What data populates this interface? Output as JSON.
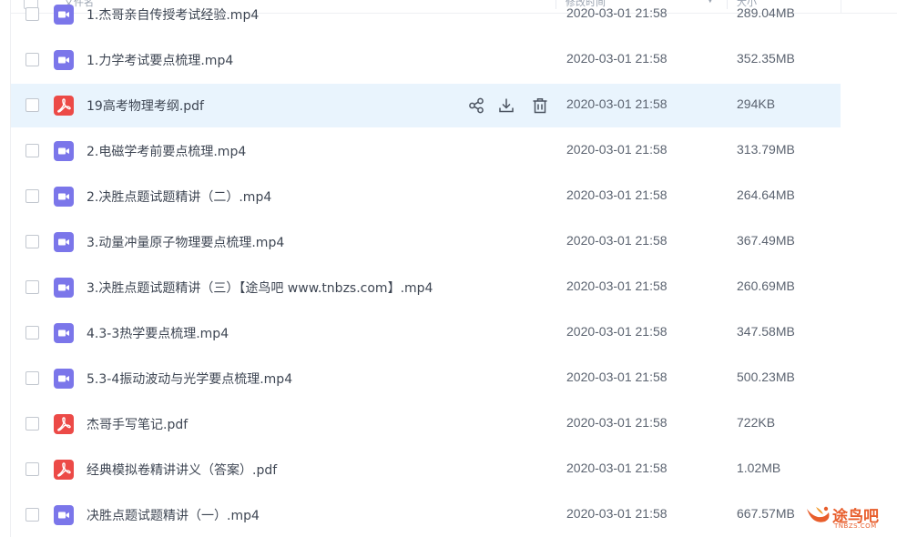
{
  "header": {
    "name_label": "文件名",
    "time_label": "修改时间",
    "size_label": "大小"
  },
  "files": [
    {
      "name": "1.杰哥亲自传授考试经验.mp4",
      "date": "2020-03-01 21:58",
      "size": "289.04MB",
      "type": "video"
    },
    {
      "name": "1.力学考试要点梳理.mp4",
      "date": "2020-03-01 21:58",
      "size": "352.35MB",
      "type": "video"
    },
    {
      "name": "19高考物理考纲.pdf",
      "date": "2020-03-01 21:58",
      "size": "294KB",
      "type": "pdf",
      "selected": true
    },
    {
      "name": "2.电磁学考前要点梳理.mp4",
      "date": "2020-03-01 21:58",
      "size": "313.79MB",
      "type": "video"
    },
    {
      "name": "2.决胜点题试题精讲（二）.mp4",
      "date": "2020-03-01 21:58",
      "size": "264.64MB",
      "type": "video"
    },
    {
      "name": "3.动量冲量原子物理要点梳理.mp4",
      "date": "2020-03-01 21:58",
      "size": "367.49MB",
      "type": "video"
    },
    {
      "name": "3.决胜点题试题精讲（三）【途鸟吧 www.tnbzs.com】.mp4",
      "date": "2020-03-01 21:58",
      "size": "260.69MB",
      "type": "video"
    },
    {
      "name": "4.3-3热学要点梳理.mp4",
      "date": "2020-03-01 21:58",
      "size": "347.58MB",
      "type": "video"
    },
    {
      "name": "5.3-4振动波动与光学要点梳理.mp4",
      "date": "2020-03-01 21:58",
      "size": "500.23MB",
      "type": "video"
    },
    {
      "name": "杰哥手写笔记.pdf",
      "date": "2020-03-01 21:58",
      "size": "722KB",
      "type": "pdf"
    },
    {
      "name": "经典模拟卷精讲讲义（答案）.pdf",
      "date": "2020-03-01 21:58",
      "size": "1.02MB",
      "type": "pdf"
    },
    {
      "name": "决胜点题试题精讲（一）.mp4",
      "date": "2020-03-01 21:58",
      "size": "667.57MB",
      "type": "video"
    }
  ],
  "row_actions": {
    "icons": [
      "share-icon",
      "download-icon",
      "delete-icon"
    ]
  },
  "watermark": {
    "name": "途鸟吧",
    "domain": "TNBZS.COM"
  },
  "colors": {
    "video_icon": "#7b76ea",
    "pdf_icon": "#ec4a47",
    "selected_row": "#e9f4fd",
    "watermark": "#e85e2c"
  }
}
